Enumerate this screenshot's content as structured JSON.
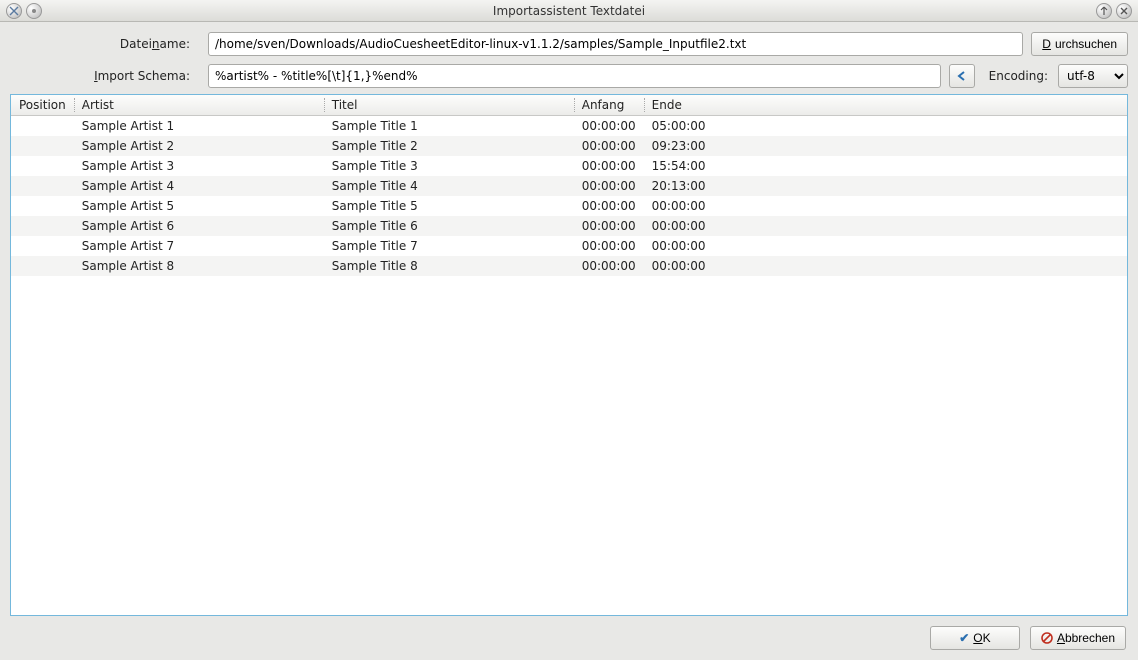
{
  "window": {
    "title": "Importassistent Textdatei"
  },
  "form": {
    "filename_label_pre": "Datei",
    "filename_label_u": "n",
    "filename_label_post": "ame:",
    "filename_value": "/home/sven/Downloads/AudioCuesheetEditor-linux-v1.1.2/samples/Sample_Inputfile2.txt",
    "browse_label_u": "D",
    "browse_label_post": "urchsuchen",
    "schema_label_u": "I",
    "schema_label_post": "mport Schema:",
    "schema_value": "%artist% - %title%[\\t]{1,}%end%",
    "encoding_label": "Encoding:",
    "encoding_value": "utf-8"
  },
  "table": {
    "headers": {
      "position": "Position",
      "artist": "Artist",
      "title": "Titel",
      "anfang": "Anfang",
      "ende": "Ende"
    },
    "rows": [
      {
        "position": "",
        "artist": "Sample Artist 1",
        "title": "Sample Title 1",
        "anfang": "00:00:00",
        "ende": "05:00:00"
      },
      {
        "position": "",
        "artist": "Sample Artist 2",
        "title": "Sample Title 2",
        "anfang": "00:00:00",
        "ende": "09:23:00"
      },
      {
        "position": "",
        "artist": "Sample Artist 3",
        "title": "Sample Title 3",
        "anfang": "00:00:00",
        "ende": "15:54:00"
      },
      {
        "position": "",
        "artist": "Sample Artist 4",
        "title": "Sample Title 4",
        "anfang": "00:00:00",
        "ende": "20:13:00"
      },
      {
        "position": "",
        "artist": "Sample Artist 5",
        "title": "Sample Title 5",
        "anfang": "00:00:00",
        "ende": "00:00:00"
      },
      {
        "position": "",
        "artist": "Sample Artist 6",
        "title": "Sample Title 6",
        "anfang": "00:00:00",
        "ende": "00:00:00"
      },
      {
        "position": "",
        "artist": "Sample Artist 7",
        "title": "Sample Title 7",
        "anfang": "00:00:00",
        "ende": "00:00:00"
      },
      {
        "position": "",
        "artist": "Sample Artist 8",
        "title": "Sample Title 8",
        "anfang": "00:00:00",
        "ende": "00:00:00"
      }
    ]
  },
  "buttons": {
    "ok_u": "O",
    "ok_post": "K",
    "cancel_u": "A",
    "cancel_post": "bbrechen"
  }
}
